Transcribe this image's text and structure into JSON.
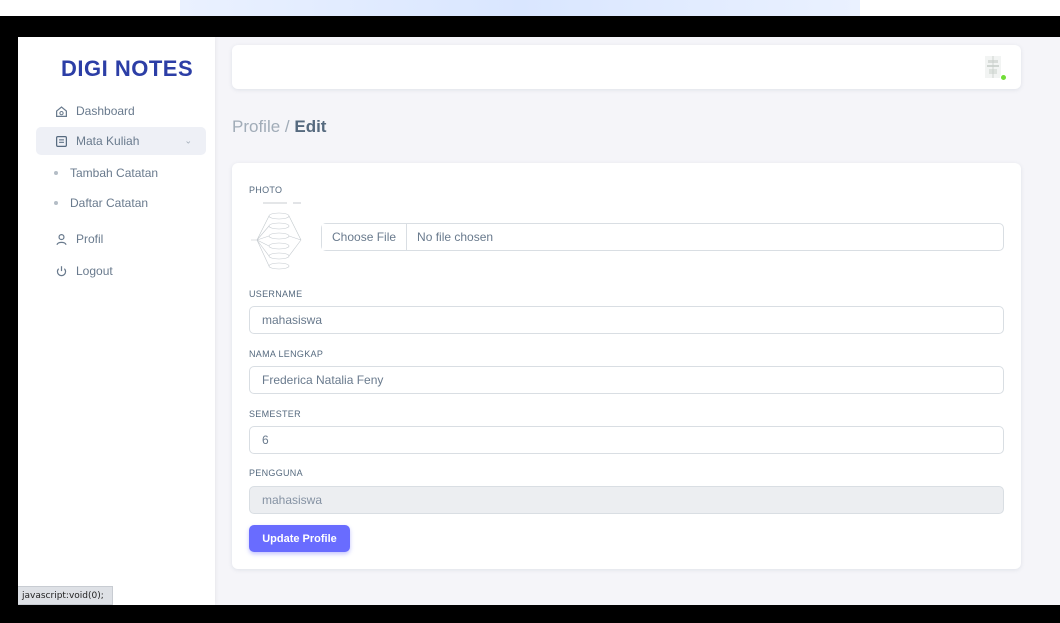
{
  "app": {
    "brand": "DIGI NOTES"
  },
  "sidebar": {
    "items": [
      {
        "label": "Dashboard",
        "icon": "home-icon"
      },
      {
        "label": "Mata Kuliah",
        "icon": "notes-icon"
      },
      {
        "label": "Tambah Catatan"
      },
      {
        "label": "Daftar Catatan"
      },
      {
        "label": "Profil",
        "icon": "user-icon"
      },
      {
        "label": "Logout",
        "icon": "power-icon"
      }
    ]
  },
  "page": {
    "breadcrumb_parent": "Profile / ",
    "title": "Edit"
  },
  "form": {
    "photo_label": "PHOTO",
    "file_button": "Choose File",
    "file_status": "No file chosen",
    "username_label": "USERNAME",
    "username_value": "mahasiswa",
    "fullname_label": "NAMA LENGKAP",
    "fullname_value": "Frederica Natalia Feny",
    "semester_label": "SEMESTER",
    "semester_value": "6",
    "pengguna_label": "PENGGUNA",
    "pengguna_value": "mahasiswa",
    "submit_label": "Update Profile"
  },
  "statusbar": {
    "text": "javascript:void(0);"
  },
  "colors": {
    "brand": "#2c3ea6",
    "primary": "#696cff",
    "online": "#71dd37"
  }
}
